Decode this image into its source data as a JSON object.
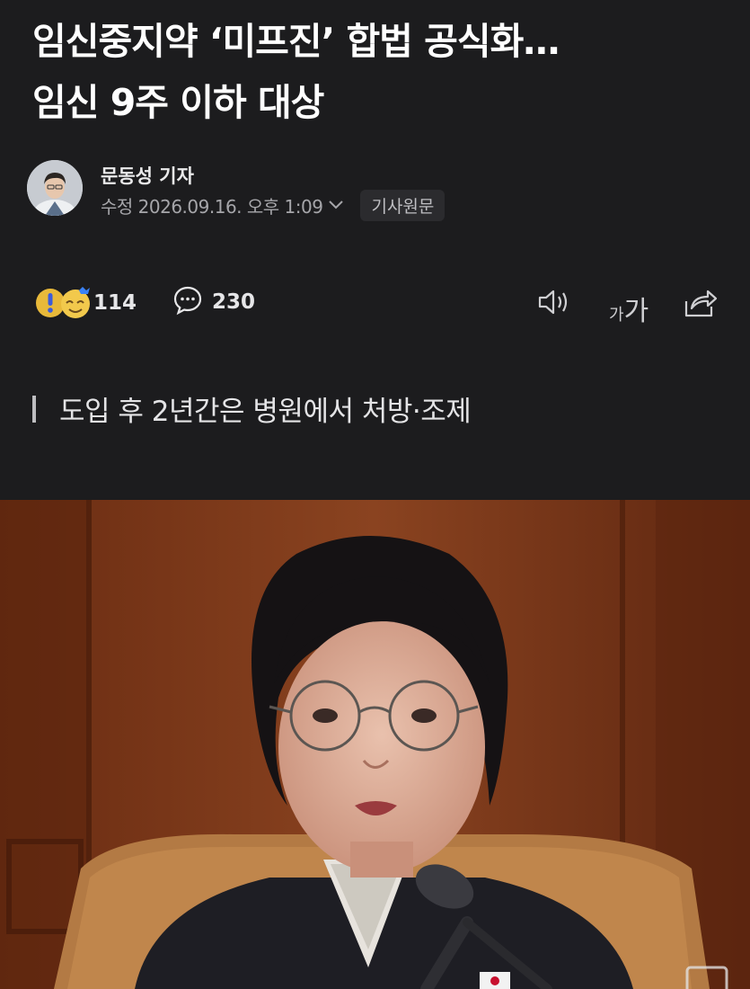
{
  "article": {
    "headline_line1": "임신중지약 ‘미프진’ 합법 공식화…",
    "headline_line2": "임신 9주 이하 대상",
    "reporter": "문동성 기자",
    "timestamp": "수정 2026.09.16. 오후 1:09",
    "source_button": "기사원문",
    "subheading": "도입 후 2년간은 병원에서 처방·조제"
  },
  "actions": {
    "reaction_count": "114",
    "comment_count": "230",
    "font_size_small": "가",
    "font_size_large": "가"
  },
  "icons": {
    "reaction": "reaction-emoji-icon",
    "comment": "speech-bubble-icon",
    "listen": "speaker-icon",
    "share": "share-icon",
    "dropdown": "chevron-down-icon"
  },
  "colors": {
    "background": "#1c1c1e",
    "text": "#ffffff",
    "muted": "#a6a6aa",
    "reaction_yellow": "#f2c94c",
    "reaction_blue": "#3b82f6"
  }
}
